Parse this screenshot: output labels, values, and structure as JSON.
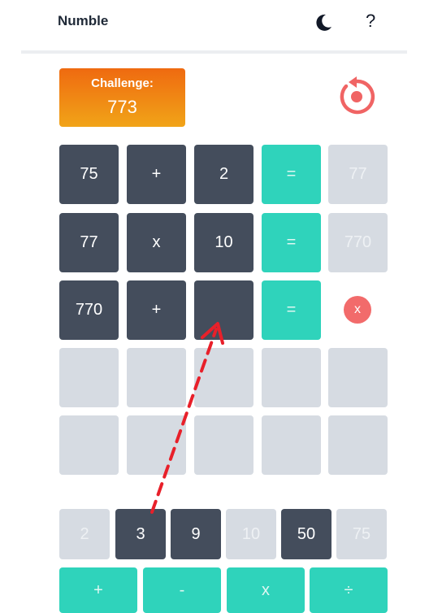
{
  "app": {
    "title": "Numble"
  },
  "challenge": {
    "label": "Challenge:",
    "value": "773"
  },
  "rows": [
    {
      "a": "75",
      "op": "+",
      "b": "2",
      "eq": "=",
      "result": "77"
    },
    {
      "a": "77",
      "op": "x",
      "b": "10",
      "eq": "=",
      "result": "770"
    },
    {
      "a": "770",
      "op": "+",
      "b": "",
      "eq": "=",
      "result": "x"
    }
  ],
  "numbers": [
    {
      "value": "2",
      "used": true
    },
    {
      "value": "3",
      "used": false
    },
    {
      "value": "9",
      "used": false
    },
    {
      "value": "10",
      "used": true
    },
    {
      "value": "50",
      "used": false
    },
    {
      "value": "75",
      "used": true
    }
  ],
  "operators": [
    "+",
    "-",
    "x",
    "÷"
  ],
  "colors": {
    "dark_tile": "#444d5c",
    "teal": "#2fd3bb",
    "light_tile": "#d6dbe2",
    "clear_red": "#f26b6b",
    "challenge_gradient": [
      "#ef6a10",
      "#f1a418"
    ],
    "reset_icon": "#f06464",
    "drag_arrow": "#e8202a"
  },
  "icons": {
    "dark_mode": "moon-icon",
    "help": "question-mark-icon",
    "reset": "reset-icon",
    "drag_hint": "drag-arrow-icon"
  }
}
